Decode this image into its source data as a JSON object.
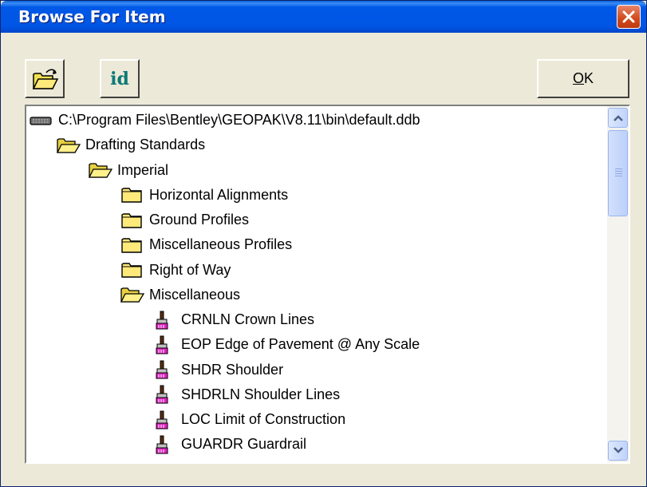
{
  "window": {
    "title": "Browse For Item",
    "title_bar_color": "#0055e5",
    "close_icon": "close-icon"
  },
  "toolbar": {
    "open_icon": "open-folder-icon",
    "id_label": "id",
    "ok_label_underlined": "O",
    "ok_label_rest": "K"
  },
  "tree": {
    "items": [
      {
        "label": "C:\\Program Files\\Bentley\\GEOPAK\\V8.11\\bin\\default.ddb",
        "icon": "database-icon",
        "level": 0
      },
      {
        "label": "Drafting Standards",
        "icon": "open-folder-icon",
        "level": 1
      },
      {
        "label": "Imperial",
        "icon": "open-folder-icon",
        "level": 2
      },
      {
        "label": "Horizontal Alignments",
        "icon": "folder-icon",
        "level": 3
      },
      {
        "label": "Ground Profiles",
        "icon": "folder-icon",
        "level": 3
      },
      {
        "label": "Miscellaneous Profiles",
        "icon": "folder-icon",
        "level": 3
      },
      {
        "label": "Right of Way",
        "icon": "folder-icon",
        "level": 3
      },
      {
        "label": "Miscellaneous",
        "icon": "open-folder-icon",
        "level": 3
      },
      {
        "label": "CRNLN Crown Lines",
        "icon": "paint-brush-icon",
        "level": 4
      },
      {
        "label": "EOP Edge of Pavement @ Any Scale",
        "icon": "paint-brush-icon",
        "level": 4
      },
      {
        "label": "SHDR Shoulder",
        "icon": "paint-brush-icon",
        "level": 4
      },
      {
        "label": "SHDRLN Shoulder Lines",
        "icon": "paint-brush-icon",
        "level": 4
      },
      {
        "label": "LOC Limit of Construction",
        "icon": "paint-brush-icon",
        "level": 4
      },
      {
        "label": "GUARDR Guardrail",
        "icon": "paint-brush-icon",
        "level": 4
      }
    ]
  },
  "scrollbar": {
    "up_icon": "scroll-up-arrow-icon",
    "down_icon": "scroll-down-arrow-icon"
  }
}
